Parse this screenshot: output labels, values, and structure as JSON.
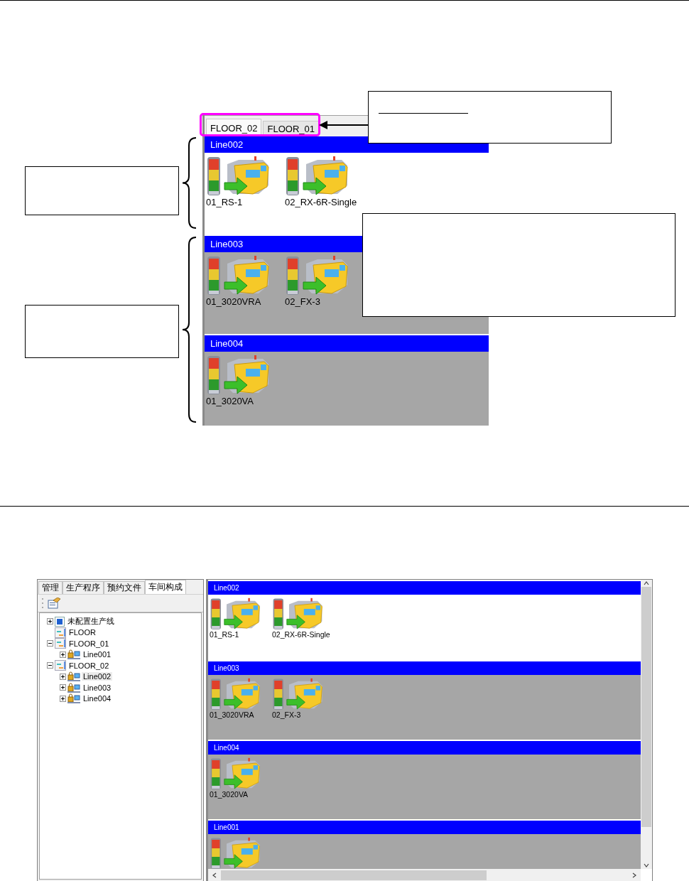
{
  "overview": {
    "tabs": [
      {
        "label": "FLOOR_02",
        "selected": true
      },
      {
        "label": "FLOOR_01",
        "selected": false
      }
    ],
    "lines": [
      {
        "title": "Line002",
        "selected": true,
        "machines": [
          {
            "kind": "machine",
            "name": "01_RS-1"
          },
          {
            "kind": "machine",
            "name": "02_RX-6R-Single"
          }
        ]
      },
      {
        "title": "Line003",
        "selected": false,
        "machines": [
          {
            "kind": "machine",
            "name": "01_3020VRA"
          },
          {
            "kind": "machine",
            "name": "02_FX-3"
          }
        ]
      },
      {
        "title": "Line004",
        "selected": false,
        "machines": [
          {
            "kind": "machine",
            "name": "01_3020VA"
          }
        ]
      }
    ]
  },
  "app": {
    "tabs": [
      {
        "label": "管理",
        "selected": false
      },
      {
        "label": "生产程序",
        "selected": false
      },
      {
        "label": "预约文件",
        "selected": false
      },
      {
        "label": "车间构成",
        "selected": true
      }
    ],
    "tree": [
      {
        "label": "未配置生产线",
        "kind": "unassigned",
        "expanded": false,
        "selected": false
      },
      {
        "label": "FLOOR",
        "kind": "floor",
        "selected": false
      },
      {
        "label": "FLOOR_01",
        "kind": "floor",
        "expanded": true,
        "selected": false,
        "children": [
          {
            "label": "Line001",
            "kind": "line",
            "expanded": false,
            "selected": false
          }
        ]
      },
      {
        "label": "FLOOR_02",
        "kind": "floor",
        "expanded": true,
        "selected": false,
        "children": [
          {
            "label": "Line002",
            "kind": "line",
            "expanded": false,
            "selected": true
          },
          {
            "label": "Line003",
            "kind": "line",
            "expanded": false,
            "selected": false
          },
          {
            "label": "Line004",
            "kind": "line",
            "expanded": false,
            "selected": false
          }
        ]
      }
    ],
    "lines": [
      {
        "title": "Line002",
        "selected": true,
        "machines": [
          {
            "kind": "machine",
            "name": "01_RS-1"
          },
          {
            "kind": "machine",
            "name": "02_RX-6R-Single"
          }
        ]
      },
      {
        "title": "Line003",
        "selected": false,
        "machines": [
          {
            "kind": "machine",
            "name": "01_3020VRA"
          },
          {
            "kind": "machine",
            "name": "02_FX-3"
          }
        ]
      },
      {
        "title": "Line004",
        "selected": false,
        "machines": [
          {
            "kind": "machine",
            "name": "01_3020VA"
          }
        ]
      },
      {
        "title": "Line001",
        "selected": false,
        "machines": [
          {
            "kind": "machine"
          }
        ]
      }
    ]
  }
}
